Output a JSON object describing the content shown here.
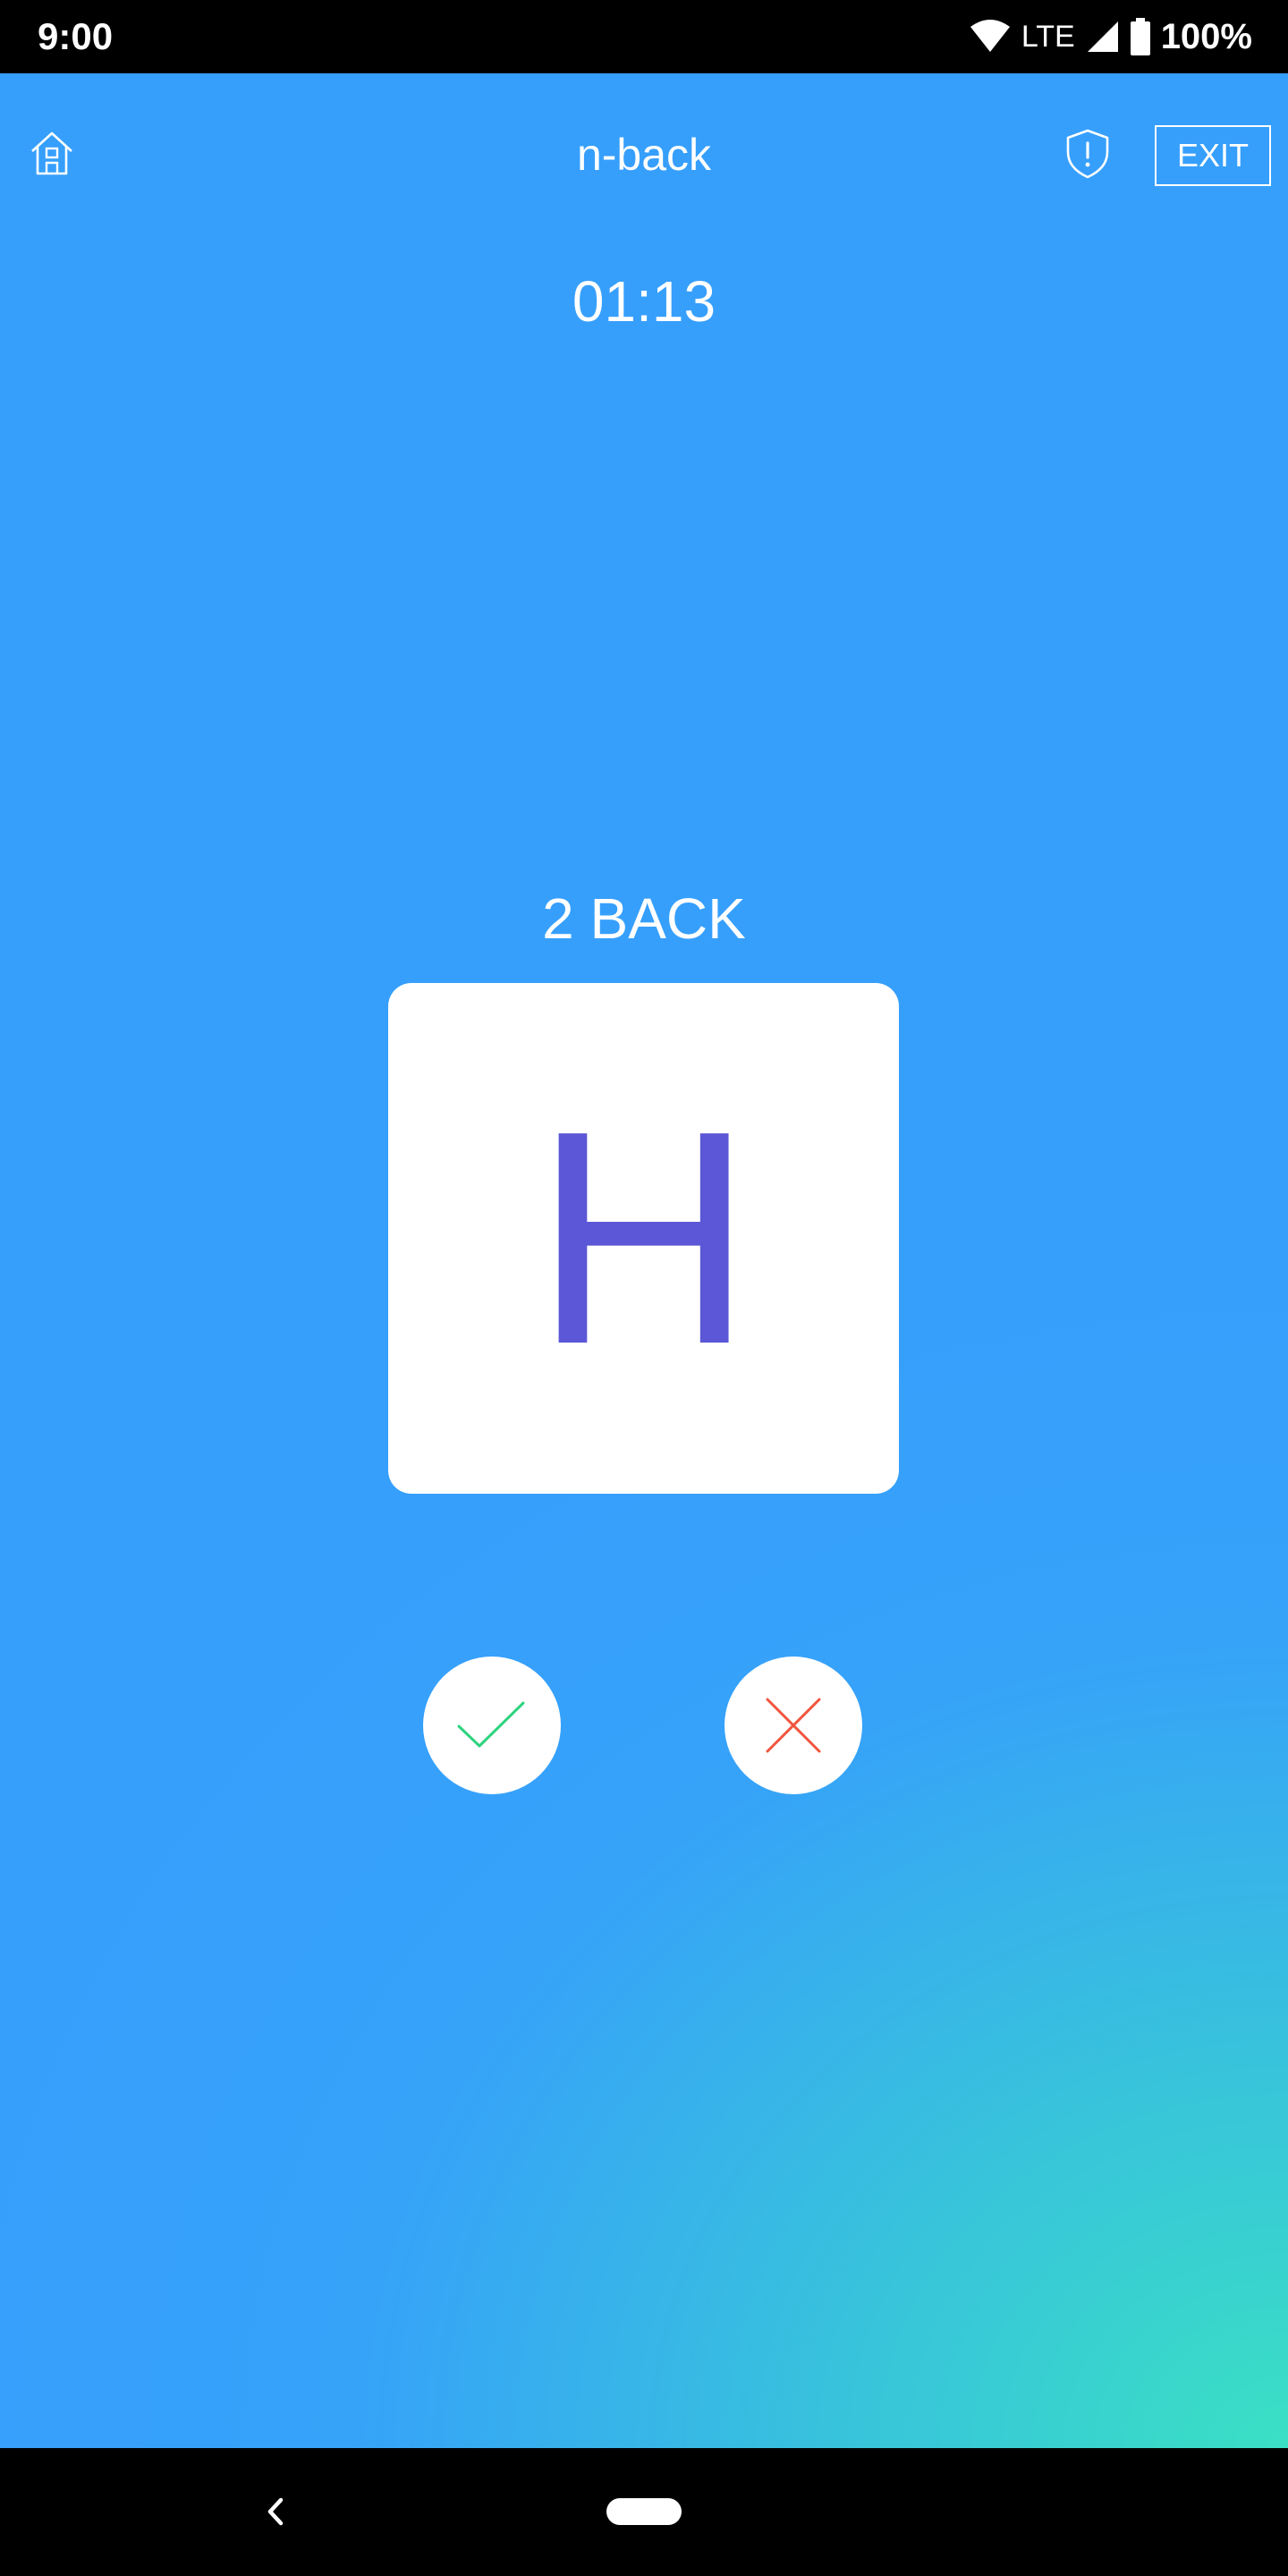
{
  "status_bar": {
    "time": "9:00",
    "network": "LTE",
    "battery": "100%",
    "icons": [
      "wifi-icon",
      "cell-signal-icon",
      "battery-icon"
    ]
  },
  "header": {
    "title": "n-back",
    "exit_label": "EXIT",
    "icons": [
      "home-icon",
      "shield-alert-icon"
    ]
  },
  "game": {
    "timer": "01:13",
    "level_label": "2 BACK",
    "current_letter": "H",
    "letter_color": "#5b57d6",
    "match_button_icon": "check-icon",
    "match_button_color": "#2ed37f",
    "no_match_button_icon": "cross-icon",
    "no_match_button_color": "#f0553e"
  },
  "theme": {
    "background_top": "#369ffc",
    "background_bottom_corner": "#3ae0c4"
  },
  "nav_bar": {
    "icons": [
      "back-chevron-icon",
      "home-pill-icon"
    ]
  }
}
